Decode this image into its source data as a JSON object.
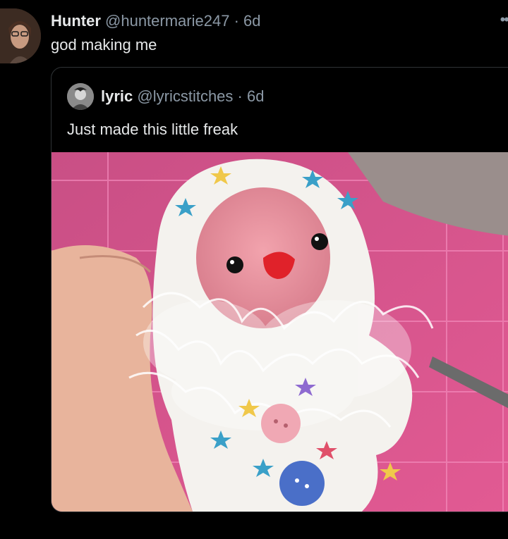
{
  "tweet": {
    "author_name": "Hunter",
    "handle": "@huntermarie247",
    "separator": "·",
    "time": "6d",
    "text": "god making me",
    "more_icon": "more-icon"
  },
  "quote": {
    "author_name": "lyric",
    "handle": "@lyricstitches",
    "separator": "·",
    "time": "6d",
    "text": "Just made this little freak",
    "media": {
      "icon": "photo-icon"
    }
  },
  "colors": {
    "background": "#000000",
    "primary_text": "#e7e9ea",
    "secondary_text": "#8b98a5",
    "border": "#2f3336"
  }
}
